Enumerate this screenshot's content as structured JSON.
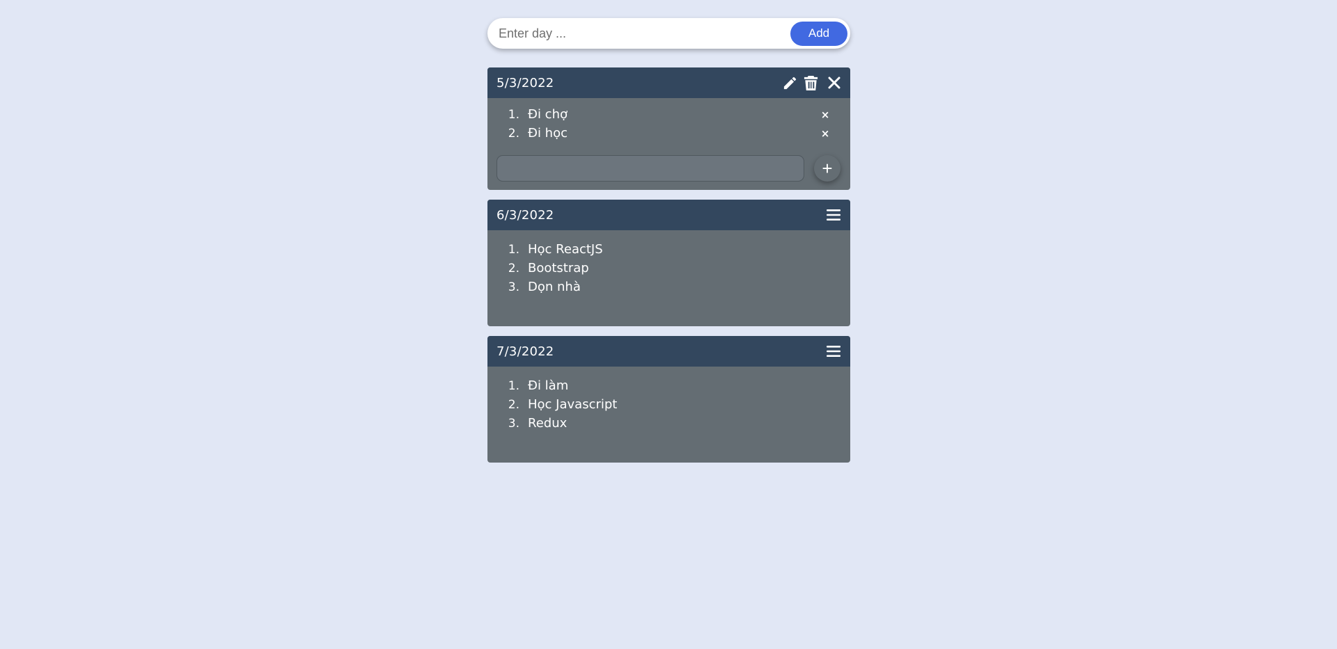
{
  "day_form": {
    "placeholder": "Enter day ...",
    "value": "",
    "add_label": "Add"
  },
  "cards": [
    {
      "date": "5/3/2022",
      "items": [
        {
          "num": "1.",
          "text": "Đi chợ",
          "remove": "×"
        },
        {
          "num": "2.",
          "text": "Đi học",
          "remove": "×"
        }
      ],
      "icons": [
        "pencil-icon",
        "trash-icon",
        "close-icon"
      ],
      "add_item": {
        "value": "",
        "plus": "+"
      }
    },
    {
      "date": "6/3/2022",
      "items": [
        {
          "num": "1.",
          "text": "Học ReactJS"
        },
        {
          "num": "2.",
          "text": "Bootstrap"
        },
        {
          "num": "3.",
          "text": "Dọn nhà"
        }
      ],
      "icons": [
        "menu-icon"
      ]
    },
    {
      "date": "7/3/2022",
      "items": [
        {
          "num": "1.",
          "text": "Đi làm"
        },
        {
          "num": "2.",
          "text": "Học Javascript"
        },
        {
          "num": "3.",
          "text": "Redux"
        }
      ],
      "icons": [
        "menu-icon"
      ]
    }
  ],
  "colors": {
    "page_bg": "#e1e7f5",
    "header_bg": "#33475e",
    "body_bg": "#646d73",
    "accent": "#4169e1"
  }
}
